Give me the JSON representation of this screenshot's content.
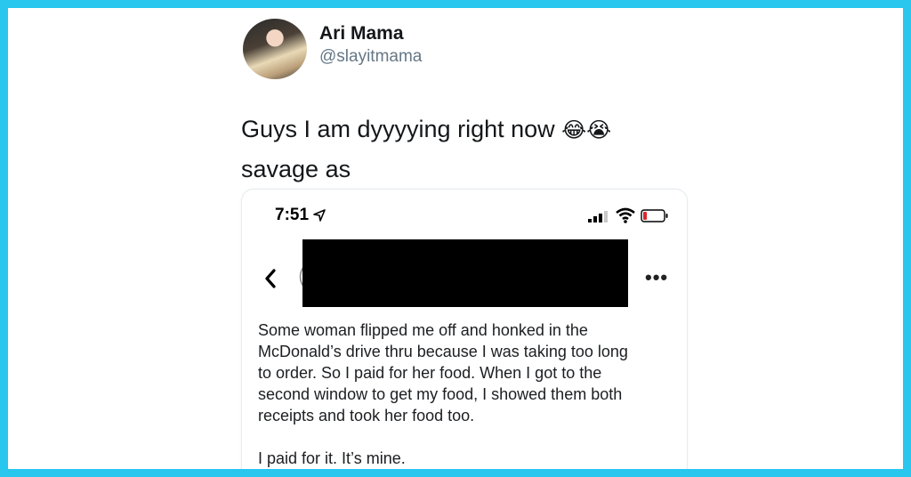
{
  "tweet": {
    "author_name": "Ari Mama",
    "author_handle": "@slayitmama",
    "text_line1": "Guys I am dyyyying right now ",
    "emoji": "😂😭",
    "text_line2": "savage as"
  },
  "screenshot": {
    "status_time": "7:51",
    "post_lines": [
      "Some woman flipped me off and honked in the",
      "McDonald’s drive thru because I was taking too long",
      "to order. So I paid for her food. When I got to the",
      "second window to get my food, I showed them both",
      "receipts and took her food too."
    ],
    "post_last_line": "I paid for it. It’s mine.",
    "more_label": "•••"
  },
  "colors": {
    "frame_border": "#29c6ee",
    "battery_low": "#e0252b"
  },
  "icons": [
    "location-arrow-icon",
    "signal-icon",
    "wifi-icon",
    "battery-icon",
    "back-chevron-icon",
    "more-icon"
  ]
}
